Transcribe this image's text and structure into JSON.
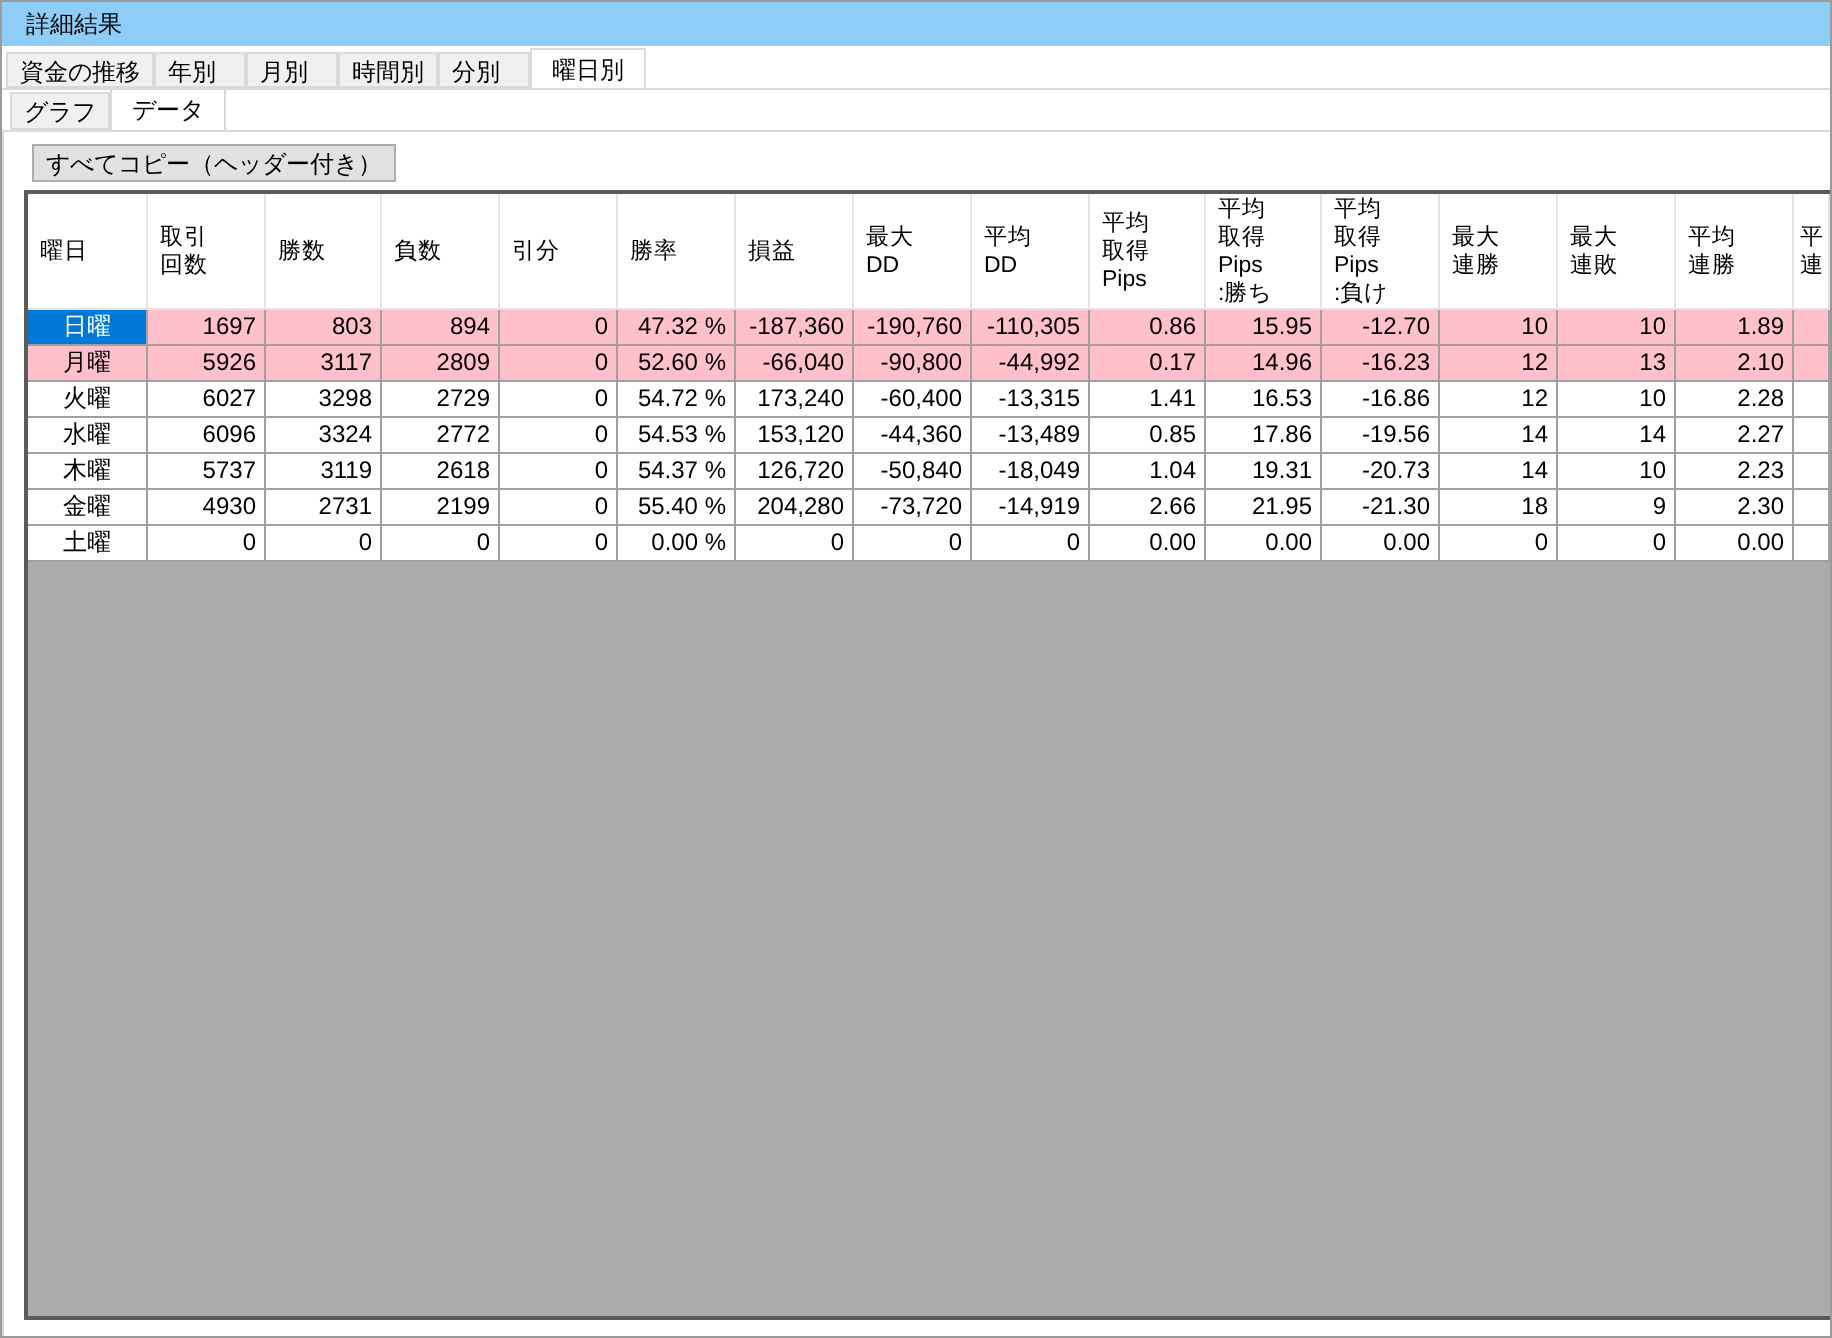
{
  "window": {
    "title": "詳細結果"
  },
  "tabs": [
    {
      "label": "資金の推移",
      "selected": false
    },
    {
      "label": "年別",
      "selected": false
    },
    {
      "label": "月別",
      "selected": false
    },
    {
      "label": "時間別",
      "selected": false
    },
    {
      "label": "分別",
      "selected": false
    },
    {
      "label": "曜日別",
      "selected": true
    }
  ],
  "subtabs": [
    {
      "label": "グラフ",
      "selected": false
    },
    {
      "label": "データ",
      "selected": true
    }
  ],
  "copy_button": "すべてコピー（ヘッダー付き）",
  "table": {
    "columns": [
      "曜日",
      "取引回数",
      "勝数",
      "負数",
      "引分",
      "勝率",
      "損益",
      "最大DD",
      "平均DD",
      "平均取得Pips",
      "平均取得Pips:勝ち",
      "平均取得Pips:負け",
      "最大連勝",
      "最大連敗",
      "平均連勝",
      "平連"
    ],
    "rows": [
      {
        "highlighted": true,
        "selected": true,
        "cells": [
          "日曜",
          "1697",
          "803",
          "894",
          "0",
          "47.32 %",
          "-187,360",
          "-190,760",
          "-110,305",
          "0.86",
          "15.95",
          "-12.70",
          "10",
          "10",
          "1.89"
        ]
      },
      {
        "highlighted": true,
        "selected": false,
        "cells": [
          "月曜",
          "5926",
          "3117",
          "2809",
          "0",
          "52.60 %",
          "-66,040",
          "-90,800",
          "-44,992",
          "0.17",
          "14.96",
          "-16.23",
          "12",
          "13",
          "2.10"
        ]
      },
      {
        "highlighted": false,
        "selected": false,
        "cells": [
          "火曜",
          "6027",
          "3298",
          "2729",
          "0",
          "54.72 %",
          "173,240",
          "-60,400",
          "-13,315",
          "1.41",
          "16.53",
          "-16.86",
          "12",
          "10",
          "2.28"
        ]
      },
      {
        "highlighted": false,
        "selected": false,
        "cells": [
          "水曜",
          "6096",
          "3324",
          "2772",
          "0",
          "54.53 %",
          "153,120",
          "-44,360",
          "-13,489",
          "0.85",
          "17.86",
          "-19.56",
          "14",
          "14",
          "2.27"
        ]
      },
      {
        "highlighted": false,
        "selected": false,
        "cells": [
          "木曜",
          "5737",
          "3119",
          "2618",
          "0",
          "54.37 %",
          "126,720",
          "-50,840",
          "-18,049",
          "1.04",
          "19.31",
          "-20.73",
          "14",
          "10",
          "2.23"
        ]
      },
      {
        "highlighted": false,
        "selected": false,
        "cells": [
          "金曜",
          "4930",
          "2731",
          "2199",
          "0",
          "55.40 %",
          "204,280",
          "-73,720",
          "-14,919",
          "2.66",
          "21.95",
          "-21.30",
          "18",
          "9",
          "2.30"
        ]
      },
      {
        "highlighted": false,
        "selected": false,
        "cells": [
          "土曜",
          "0",
          "0",
          "0",
          "0",
          "0.00 %",
          "0",
          "0",
          "0",
          "0.00",
          "0.00",
          "0.00",
          "0",
          "0",
          "0.00"
        ]
      }
    ]
  }
}
